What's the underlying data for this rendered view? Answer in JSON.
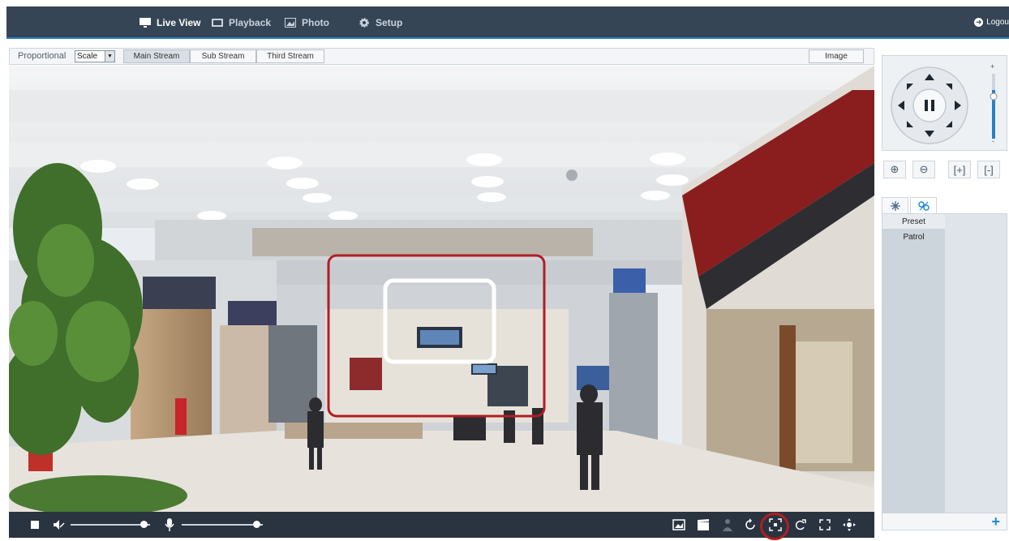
{
  "nav": {
    "items": [
      {
        "label": "Live View",
        "icon": "monitor-icon"
      },
      {
        "label": "Playback",
        "icon": "film-icon"
      },
      {
        "label": "Photo",
        "icon": "image-icon"
      },
      {
        "label": "Setup",
        "icon": "gear-icon"
      }
    ],
    "active": "Live View",
    "logout_label": "Logou"
  },
  "stream_bar": {
    "proportional_label": "Proportional",
    "scale_value": "Scale",
    "streams": [
      "Main Stream",
      "Sub Stream",
      "Third Stream"
    ],
    "active_stream": "Main Stream",
    "image_label": "Image"
  },
  "controls": {
    "icons": [
      "stop-icon",
      "speaker-mute-icon",
      "microphone-icon",
      "snapshot-icon",
      "clip-icon",
      "person-icon",
      "rotate-icon",
      "area-zoom-icon",
      "zoom-out-region-icon",
      "fullscreen-icon",
      "ptz-icon"
    ],
    "volume_level": 0.9,
    "mic_level": 0.9,
    "highlighted_control": "area-zoom-icon"
  },
  "ptz": {
    "direction_icons": [
      "up-arrow-icon",
      "down-arrow-icon",
      "left-arrow-icon",
      "right-arrow-icon",
      "pause-icon"
    ],
    "speed_plus": "+",
    "speed_minus": "-",
    "speed_level": 0.75,
    "buttons": [
      "zoom-in-icon",
      "zoom-out-icon",
      "focus-near-icon",
      "focus-far-icon"
    ]
  },
  "preset_panel": {
    "tabs": [
      "preset-tab-icon",
      "patrol-tab-icon"
    ],
    "items": [
      "Preset",
      "Patrol"
    ],
    "active_item": "Preset",
    "add_label": "+"
  },
  "colors": {
    "topbar": "#364556",
    "accent": "#2b7fc2",
    "control_bar": "#2a3340",
    "highlight_red": "#b01e23"
  }
}
